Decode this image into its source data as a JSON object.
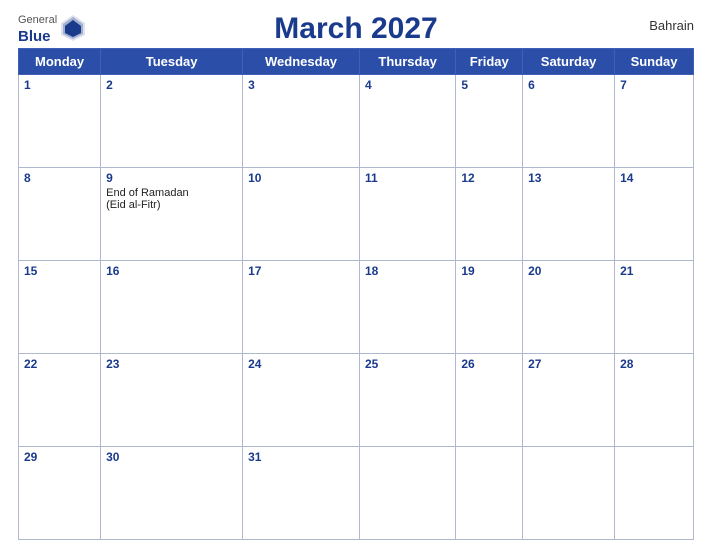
{
  "header": {
    "logo_general": "General",
    "logo_blue": "Blue",
    "title": "March 2027",
    "country": "Bahrain"
  },
  "days_of_week": [
    "Monday",
    "Tuesday",
    "Wednesday",
    "Thursday",
    "Friday",
    "Saturday",
    "Sunday"
  ],
  "weeks": [
    {
      "dates": [
        1,
        2,
        3,
        4,
        5,
        6,
        7
      ],
      "events": {
        "1": "",
        "2": "",
        "3": "",
        "4": "",
        "5": "",
        "6": "",
        "7": ""
      }
    },
    {
      "dates": [
        8,
        9,
        10,
        11,
        12,
        13,
        14
      ],
      "events": {
        "8": "",
        "9": "End of Ramadan\n(Eid al-Fitr)",
        "10": "",
        "11": "",
        "12": "",
        "13": "",
        "14": ""
      }
    },
    {
      "dates": [
        15,
        16,
        17,
        18,
        19,
        20,
        21
      ],
      "events": {
        "15": "",
        "16": "",
        "17": "",
        "18": "",
        "19": "",
        "20": "",
        "21": ""
      }
    },
    {
      "dates": [
        22,
        23,
        24,
        25,
        26,
        27,
        28
      ],
      "events": {
        "22": "",
        "23": "",
        "24": "",
        "25": "",
        "26": "",
        "27": "",
        "28": ""
      }
    },
    {
      "dates": [
        29,
        30,
        31,
        null,
        null,
        null,
        null
      ],
      "events": {
        "29": "",
        "30": "",
        "31": ""
      }
    }
  ]
}
